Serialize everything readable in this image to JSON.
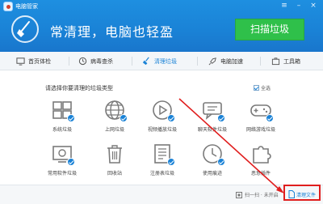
{
  "window": {
    "title": "电脑管家",
    "controls": [
      "menu-icon",
      "minimize-icon",
      "close-icon"
    ]
  },
  "hero": {
    "tagline": "常清理，电脑也轻盈",
    "scan_button": "扫描垃圾"
  },
  "nav": {
    "items": [
      {
        "label": "首页体检",
        "icon": "home-icon"
      },
      {
        "label": "病毒查杀",
        "icon": "shield-icon"
      },
      {
        "label": "清理垃圾",
        "icon": "broom-icon",
        "active": true
      },
      {
        "label": "电脑加速",
        "icon": "rocket-icon"
      },
      {
        "label": "工具箱",
        "icon": "toolbox-icon"
      }
    ]
  },
  "content": {
    "prompt": "请选择你要清理的垃圾类型",
    "select_all": "全选",
    "tiles": [
      {
        "label": "系统垃圾",
        "icon": "windows-icon",
        "checked": true
      },
      {
        "label": "上网垃圾",
        "icon": "globe-icon",
        "checked": true
      },
      {
        "label": "视频播放垃圾",
        "icon": "play-icon",
        "checked": true
      },
      {
        "label": "聊天软件垃圾",
        "icon": "chat-icon",
        "checked": true
      },
      {
        "label": "网络游戏垃圾",
        "icon": "gamepad-icon",
        "checked": true
      },
      {
        "label": "常用软件垃圾",
        "icon": "software-icon",
        "checked": true
      },
      {
        "label": "回收站",
        "icon": "trash-icon",
        "checked": false
      },
      {
        "label": "注册表垃圾",
        "icon": "registry-icon",
        "checked": true
      },
      {
        "label": "使用痕迹",
        "icon": "clock-icon",
        "checked": true
      },
      {
        "label": "恶意插件",
        "icon": "puzzle-icon",
        "checked": false
      }
    ]
  },
  "footer": {
    "left": "扫一扫 · 未开启",
    "right": "清理文件"
  },
  "colors": {
    "header": "#1a82d6",
    "accent": "#1a82d6",
    "scan_button": "#2fc04a",
    "annotation": "#e01e1e"
  }
}
